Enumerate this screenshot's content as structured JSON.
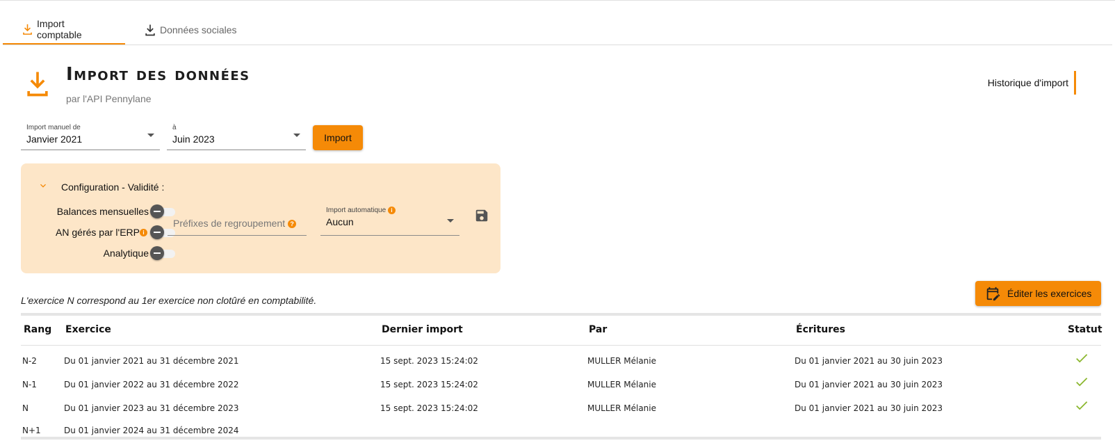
{
  "tabs": [
    {
      "label": "Import comptable",
      "active": true
    },
    {
      "label": "Données sociales",
      "active": false
    }
  ],
  "header": {
    "title": "Import des données",
    "subtitle": "par l'API Pennylane",
    "history_link": "Historique d'import"
  },
  "date_range": {
    "from_label": "Import manuel de",
    "from_value": "Janvier 2021",
    "to_label": "à",
    "to_value": "Juin 2023",
    "import_button": "Import"
  },
  "config": {
    "title": "Configuration - Validité :",
    "toggles": [
      {
        "label": "Balances mensuelles",
        "on": false
      },
      {
        "label": "AN gérés par l'ERP",
        "on": false,
        "info": "i"
      },
      {
        "label": "Analytique",
        "on": false
      }
    ],
    "prefix_placeholder": "Préfixes de regroupement",
    "prefix_help": "?",
    "auto_import_label": "Import automatique",
    "auto_import_info": "i",
    "auto_import_value": "Aucun"
  },
  "note": "L'exercice N correspond au 1er exercice non clotûré en comptabilité.",
  "edit_button": "Éditer les exercices",
  "table": {
    "columns": [
      "Rang",
      "Exercice",
      "Dernier import",
      "Par",
      "Écritures",
      "Statut"
    ],
    "rows": [
      {
        "rang": "N-2",
        "exercice": "Du 01 janvier 2021 au 31 décembre 2021",
        "dernier_import": "15 sept. 2023 15:24:02",
        "par": "MULLER Mélanie",
        "ecritures": "Du 01 janvier 2021 au 30 juin 2023",
        "statut": "ok"
      },
      {
        "rang": "N-1",
        "exercice": "Du 01 janvier 2022 au 31 décembre 2022",
        "dernier_import": "15 sept. 2023 15:24:02",
        "par": "MULLER Mélanie",
        "ecritures": "Du 01 janvier 2021 au 30 juin 2023",
        "statut": "ok"
      },
      {
        "rang": "N",
        "exercice": "Du 01 janvier 2023 au 31 décembre 2023",
        "dernier_import": "15 sept. 2023 15:24:02",
        "par": "MULLER Mélanie",
        "ecritures": "Du 01 janvier 2021 au 30 juin 2023",
        "statut": "ok"
      },
      {
        "rang": "N+1",
        "exercice": "Du 01 janvier 2024 au 31 décembre 2024",
        "dernier_import": "",
        "par": "",
        "ecritures": "",
        "statut": ""
      }
    ]
  },
  "colors": {
    "accent": "#f58a07",
    "panel_bg": "#fde6c8",
    "check": "#8bb72e"
  }
}
